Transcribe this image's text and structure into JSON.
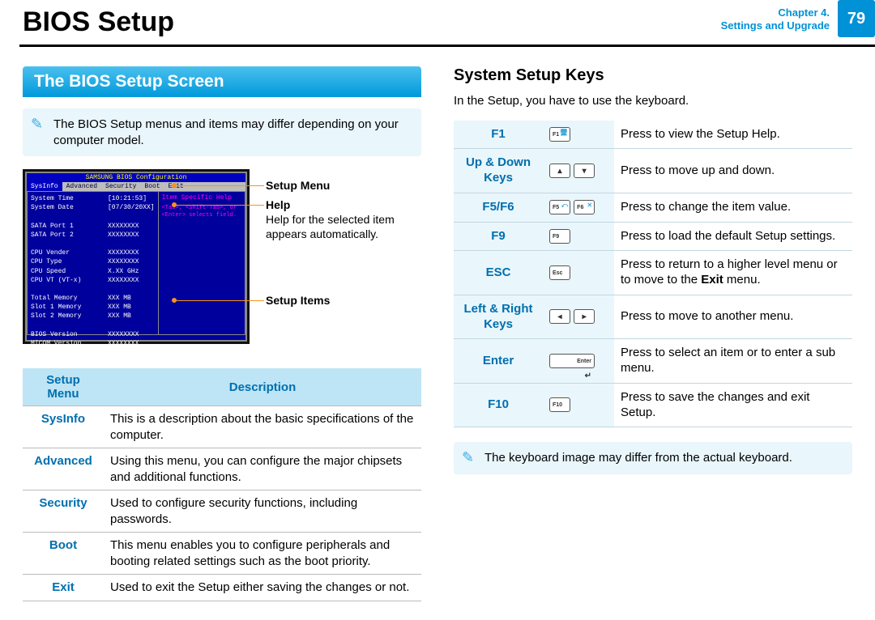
{
  "header": {
    "title": "BIOS Setup",
    "chapter_line1": "Chapter 4.",
    "chapter_line2": "Settings and Upgrade",
    "page": "79"
  },
  "left": {
    "banner": "The BIOS Setup Screen",
    "note": "The BIOS Setup menus and items may differ depending on your computer model.",
    "bios": {
      "bar": "SAMSUNG BIOS Configuration",
      "menus": [
        "SysInfo",
        "Advanced",
        "Security",
        "Boot",
        "Exit"
      ],
      "rows": [
        {
          "label": "System Time",
          "value": "[10:21:53]"
        },
        {
          "label": "System Date",
          "value": "[07/30/20XX]"
        },
        {
          "label": "",
          "value": ""
        },
        {
          "label": "SATA Port 1",
          "value": "XXXXXXXX"
        },
        {
          "label": "SATA Port 2",
          "value": "XXXXXXXX"
        },
        {
          "label": "",
          "value": ""
        },
        {
          "label": "CPU Vender",
          "value": "XXXXXXXX"
        },
        {
          "label": "CPU Type",
          "value": "XXXXXXXX"
        },
        {
          "label": "CPU Speed",
          "value": "X.XX GHz"
        },
        {
          "label": "CPU VT (VT-x)",
          "value": "XXXXXXXX"
        },
        {
          "label": "",
          "value": ""
        },
        {
          "label": "Total Memory",
          "value": "XXX MB"
        },
        {
          "label": "  Slot 1 Memory",
          "value": "XXX MB"
        },
        {
          "label": "  Slot 2 Memory",
          "value": "XXX MB"
        },
        {
          "label": "",
          "value": ""
        },
        {
          "label": "BIOS Version",
          "value": "XXXXXXXX"
        },
        {
          "label": "MICOM Version",
          "value": "XXXXXXXX"
        }
      ],
      "help_head": "Item Specific Help",
      "help_body": "<Tab>, <Shift-Tab>, or <Enter> selects field."
    },
    "callouts": {
      "setup_menu": "Setup Menu",
      "help": "Help",
      "help_desc": "Help for the selected item appears automatically.",
      "setup_items": "Setup Items"
    },
    "table": {
      "head1": "Setup Menu",
      "head2": "Description",
      "rows": [
        {
          "k": "SysInfo",
          "d": "This is a description about the basic specifications of the computer."
        },
        {
          "k": "Advanced",
          "d": "Using this menu, you can configure the major chipsets and additional functions."
        },
        {
          "k": "Security",
          "d": "Used to configure security functions, including passwords."
        },
        {
          "k": "Boot",
          "d": "This menu enables you to configure peripherals and booting related settings such as the boot priority."
        },
        {
          "k": "Exit",
          "d": "Used to exit the Setup either saving the changes or not."
        }
      ]
    }
  },
  "right": {
    "heading": "System Setup Keys",
    "intro": "In the Setup, you have to use the keyboard.",
    "rows": [
      {
        "k": "F1",
        "cap": "F1",
        "d": "Press to view the Setup Help."
      },
      {
        "k": "Up & Down Keys",
        "cap": "ud",
        "d": "Press to move up and down."
      },
      {
        "k": "F5/F6",
        "cap": "F5F6",
        "d": "Press to change the item value."
      },
      {
        "k": "F9",
        "cap": "F9",
        "d": "Press to load the default Setup settings."
      },
      {
        "k": "ESC",
        "cap": "Esc",
        "d": "Press to return to a higher level menu or to move to the Exit menu.",
        "bold": "Exit"
      },
      {
        "k": "Left & Right Keys",
        "cap": "lr",
        "d": "Press to move to another menu."
      },
      {
        "k": "Enter",
        "cap": "Enter",
        "d": "Press to select an item or to enter a sub menu."
      },
      {
        "k": "F10",
        "cap": "F10",
        "d": "Press to save the changes and exit Setup."
      }
    ],
    "note": "The keyboard image may differ from the actual keyboard."
  }
}
